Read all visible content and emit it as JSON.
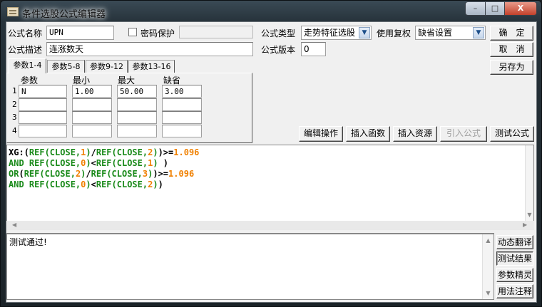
{
  "window": {
    "title": "条件选股公式编辑器",
    "controls": {
      "minimize": "–",
      "maximize": "□",
      "close": "X"
    }
  },
  "form": {
    "name_label": "公式名称",
    "name_value": "UPN",
    "password_label": "密码保护",
    "password_checked": false,
    "password_value": "",
    "type_label": "公式类型",
    "type_value": "走势特征选股",
    "adjust_label": "使用复权",
    "adjust_value": "缺省设置",
    "desc_label": "公式描述",
    "desc_value": "连涨数天",
    "version_label": "公式版本",
    "version_value": "0"
  },
  "buttons": {
    "ok": "确　定",
    "cancel": "取　消",
    "save_as": "另存为",
    "edit_ops": "编辑操作",
    "insert_func": "插入函数",
    "insert_res": "插入资源",
    "import_formula": "引入公式",
    "test_formula": "测试公式"
  },
  "tabs": [
    "参数1-4",
    "参数5-8",
    "参数9-12",
    "参数13-16"
  ],
  "params": {
    "headers": [
      "参数",
      "最小",
      "最大",
      "缺省"
    ],
    "rows": [
      {
        "num": "1",
        "cells": [
          "N",
          "1.00",
          "50.00",
          "3.00"
        ]
      },
      {
        "num": "2",
        "cells": [
          "",
          "",
          "",
          ""
        ]
      },
      {
        "num": "3",
        "cells": [
          "",
          "",
          "",
          ""
        ]
      },
      {
        "num": "4",
        "cells": [
          "",
          "",
          "",
          ""
        ]
      }
    ]
  },
  "code_colors": {
    "default": "#000000",
    "func": "#1a8a1a",
    "num": "#f08000"
  },
  "code": [
    [
      [
        "default",
        "XG:("
      ],
      [
        "func",
        "REF(CLOSE,"
      ],
      [
        "num",
        "1"
      ],
      [
        "func",
        ")"
      ],
      [
        "default",
        "/"
      ],
      [
        "func",
        "REF(CLOSE,"
      ],
      [
        "num",
        "2"
      ],
      [
        "func",
        ")"
      ],
      [
        "default",
        ")>="
      ],
      [
        "num",
        "1.096"
      ]
    ],
    [
      [
        "func",
        "AND REF(CLOSE,"
      ],
      [
        "num",
        "0"
      ],
      [
        "func",
        ")"
      ],
      [
        "default",
        "<"
      ],
      [
        "func",
        "REF(CLOSE,"
      ],
      [
        "num",
        "1"
      ],
      [
        "func",
        ")"
      ],
      [
        "default",
        " )"
      ]
    ],
    [
      [
        "func",
        "OR"
      ],
      [
        "default",
        "("
      ],
      [
        "func",
        "REF(CLOSE,"
      ],
      [
        "num",
        "2"
      ],
      [
        "func",
        ")"
      ],
      [
        "default",
        "/"
      ],
      [
        "func",
        "REF(CLOSE,"
      ],
      [
        "num",
        "3"
      ],
      [
        "func",
        ")"
      ],
      [
        "default",
        ")>="
      ],
      [
        "num",
        "1.096"
      ]
    ],
    [
      [
        "func",
        "AND REF(CLOSE,"
      ],
      [
        "num",
        "0"
      ],
      [
        "func",
        ")"
      ],
      [
        "default",
        "<"
      ],
      [
        "func",
        "REF(CLOSE,"
      ],
      [
        "num",
        "2"
      ],
      [
        "func",
        ")"
      ],
      [
        "default",
        ")"
      ]
    ]
  ],
  "output": {
    "text": "测试通过!"
  },
  "side_buttons": [
    "动态翻译",
    "测试结果",
    "参数精灵",
    "用法注释"
  ],
  "side_active": "测试结果"
}
